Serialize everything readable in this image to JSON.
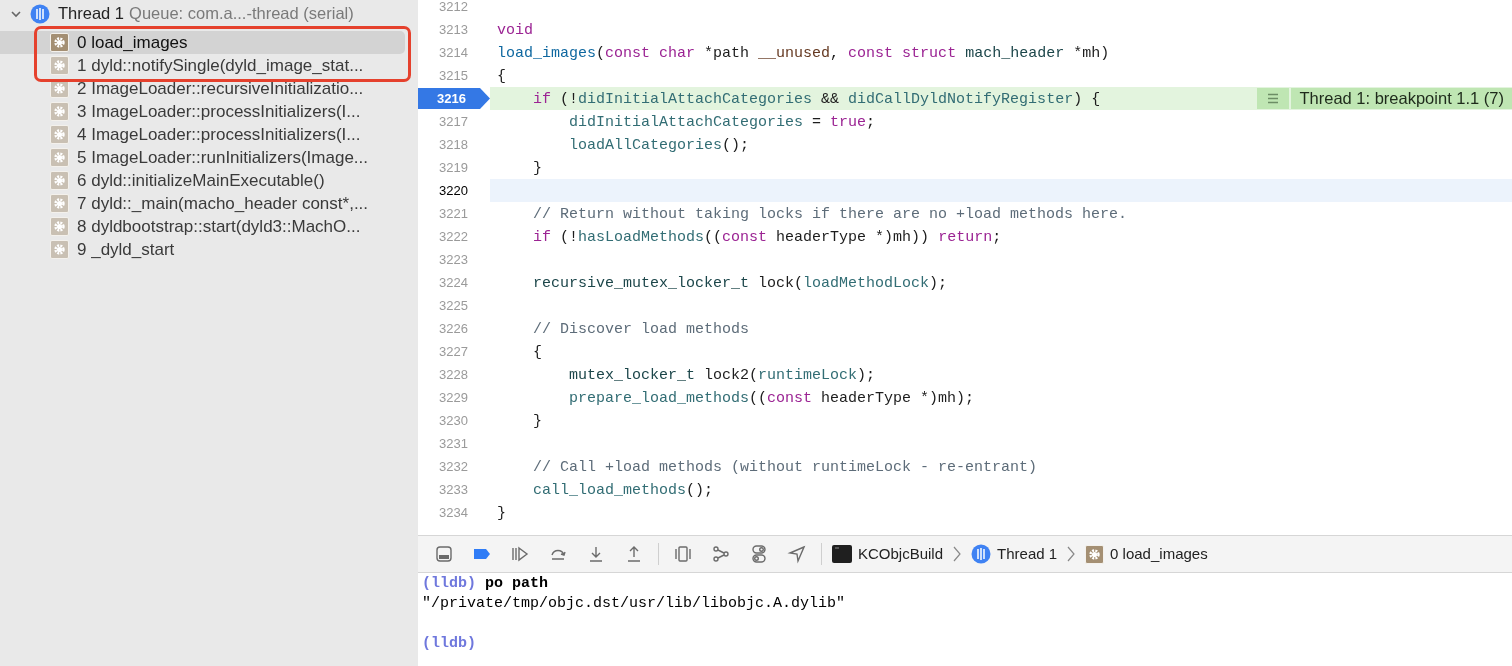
{
  "sidebar": {
    "thread": {
      "label": "Thread 1",
      "queue": "Queue: com.a...-thread (serial)",
      "expanded": true
    },
    "frames": [
      {
        "label": "0 load_images",
        "selected": true,
        "highlighted": true
      },
      {
        "label": "1 dyld::notifySingle(dyld_image_stat...",
        "selected": false,
        "highlighted": true
      },
      {
        "label": "2 ImageLoader::recursiveInitializatio...",
        "selected": false,
        "highlighted": false
      },
      {
        "label": "3 ImageLoader::processInitializers(I...",
        "selected": false,
        "highlighted": false
      },
      {
        "label": "4 ImageLoader::processInitializers(I...",
        "selected": false,
        "highlighted": false
      },
      {
        "label": "5 ImageLoader::runInitializers(Image...",
        "selected": false,
        "highlighted": false
      },
      {
        "label": "6 dyld::initializeMainExecutable()",
        "selected": false,
        "highlighted": false
      },
      {
        "label": "7 dyld::_main(macho_header const*,...",
        "selected": false,
        "highlighted": false
      },
      {
        "label": "8 dyldbootstrap::start(dyld3::MachO...",
        "selected": false,
        "highlighted": false
      },
      {
        "label": "9 _dyld_start",
        "selected": false,
        "highlighted": false
      }
    ]
  },
  "editor": {
    "lines": [
      {
        "number": "3212",
        "breakpoint": false,
        "cursor": false
      },
      {
        "number": "3213",
        "breakpoint": false,
        "cursor": false,
        "tokens": [
          {
            "text": "void",
            "kind": "keyword"
          }
        ]
      },
      {
        "number": "3214",
        "breakpoint": false,
        "cursor": false,
        "tokens": [
          {
            "text": "load_images",
            "kind": "decl"
          },
          {
            "text": "(",
            "kind": "plain"
          },
          {
            "text": "const char",
            "kind": "keyword"
          },
          {
            "text": " *path ",
            "kind": "plain"
          },
          {
            "text": "__unused",
            "kind": "macro"
          },
          {
            "text": ", ",
            "kind": "plain"
          },
          {
            "text": "const struct",
            "kind": "keyword"
          },
          {
            "text": " mach_header",
            "kind": "type"
          },
          {
            "text": " *mh)",
            "kind": "plain"
          }
        ]
      },
      {
        "number": "3215",
        "breakpoint": false,
        "cursor": false,
        "tokens": [
          {
            "text": "{",
            "kind": "plain"
          }
        ]
      },
      {
        "number": "3216",
        "breakpoint": true,
        "cursor": false,
        "annotation": "Thread 1: breakpoint 1.1 (7)",
        "tokens": [
          {
            "text": "    if",
            "kind": "keyword"
          },
          {
            "text": " (!",
            "kind": "plain"
          },
          {
            "text": "didInitialAttachCategories",
            "kind": "symbol"
          },
          {
            "text": " && ",
            "kind": "plain"
          },
          {
            "text": "didCallDyldNotifyRegister",
            "kind": "symbol"
          },
          {
            "text": ") {",
            "kind": "plain"
          }
        ]
      },
      {
        "number": "3217",
        "breakpoint": false,
        "cursor": false,
        "tokens": [
          {
            "text": "        didInitialAttachCategories",
            "kind": "symbol"
          },
          {
            "text": " = ",
            "kind": "plain"
          },
          {
            "text": "true",
            "kind": "keyword"
          },
          {
            "text": ";",
            "kind": "plain"
          }
        ]
      },
      {
        "number": "3218",
        "breakpoint": false,
        "cursor": false,
        "tokens": [
          {
            "text": "        loadAllCategories",
            "kind": "symbol"
          },
          {
            "text": "();",
            "kind": "plain"
          }
        ]
      },
      {
        "number": "3219",
        "breakpoint": false,
        "cursor": false,
        "tokens": [
          {
            "text": "    }",
            "kind": "plain"
          }
        ]
      },
      {
        "number": "3220",
        "breakpoint": false,
        "cursor": true
      },
      {
        "number": "3221",
        "breakpoint": false,
        "cursor": false,
        "tokens": [
          {
            "text": "    // Return without taking locks if there are no +load methods here.",
            "kind": "comment"
          }
        ]
      },
      {
        "number": "3222",
        "breakpoint": false,
        "cursor": false,
        "tokens": [
          {
            "text": "    if",
            "kind": "keyword"
          },
          {
            "text": " (!",
            "kind": "plain"
          },
          {
            "text": "hasLoadMethods",
            "kind": "symbol"
          },
          {
            "text": "((",
            "kind": "plain"
          },
          {
            "text": "const",
            "kind": "keyword"
          },
          {
            "text": " headerType *)mh)) ",
            "kind": "plain"
          },
          {
            "text": "return",
            "kind": "keyword"
          },
          {
            "text": ";",
            "kind": "plain"
          }
        ]
      },
      {
        "number": "3223",
        "breakpoint": false,
        "cursor": false
      },
      {
        "number": "3224",
        "breakpoint": false,
        "cursor": false,
        "tokens": [
          {
            "text": "    recursive_mutex_locker_t",
            "kind": "type"
          },
          {
            "text": " lock(",
            "kind": "plain"
          },
          {
            "text": "loadMethodLock",
            "kind": "symbol"
          },
          {
            "text": ");",
            "kind": "plain"
          }
        ]
      },
      {
        "number": "3225",
        "breakpoint": false,
        "cursor": false
      },
      {
        "number": "3226",
        "breakpoint": false,
        "cursor": false,
        "tokens": [
          {
            "text": "    // Discover load methods",
            "kind": "comment"
          }
        ]
      },
      {
        "number": "3227",
        "breakpoint": false,
        "cursor": false,
        "tokens": [
          {
            "text": "    {",
            "kind": "plain"
          }
        ]
      },
      {
        "number": "3228",
        "breakpoint": false,
        "cursor": false,
        "tokens": [
          {
            "text": "        mutex_locker_t",
            "kind": "type"
          },
          {
            "text": " lock2(",
            "kind": "plain"
          },
          {
            "text": "runtimeLock",
            "kind": "symbol"
          },
          {
            "text": ");",
            "kind": "plain"
          }
        ]
      },
      {
        "number": "3229",
        "breakpoint": false,
        "cursor": false,
        "tokens": [
          {
            "text": "        prepare_load_methods",
            "kind": "symbol"
          },
          {
            "text": "((",
            "kind": "plain"
          },
          {
            "text": "const",
            "kind": "keyword"
          },
          {
            "text": " headerType *)mh);",
            "kind": "plain"
          }
        ]
      },
      {
        "number": "3230",
        "breakpoint": false,
        "cursor": false,
        "tokens": [
          {
            "text": "    }",
            "kind": "plain"
          }
        ]
      },
      {
        "number": "3231",
        "breakpoint": false,
        "cursor": false
      },
      {
        "number": "3232",
        "breakpoint": false,
        "cursor": false,
        "tokens": [
          {
            "text": "    // Call +load methods (without runtimeLock - re-entrant)",
            "kind": "comment"
          }
        ]
      },
      {
        "number": "3233",
        "breakpoint": false,
        "cursor": false,
        "tokens": [
          {
            "text": "    call_load_methods",
            "kind": "symbol"
          },
          {
            "text": "();",
            "kind": "plain"
          }
        ]
      },
      {
        "number": "3234",
        "breakpoint": false,
        "cursor": false,
        "tokens": [
          {
            "text": "}",
            "kind": "plain"
          }
        ]
      }
    ]
  },
  "debug_bar": {
    "breadcrumb": [
      {
        "kind": "terminal",
        "label": "KCObjcBuild"
      },
      {
        "kind": "thread",
        "label": "Thread 1"
      },
      {
        "kind": "frame",
        "label": "0 load_images"
      }
    ]
  },
  "console": {
    "lines": [
      {
        "kind": "command",
        "prompt": "(lldb)",
        "text": "po path"
      },
      {
        "kind": "output",
        "text": "\"/private/tmp/objc.dst/usr/lib/libobjc.A.dylib\""
      },
      {
        "kind": "blank"
      },
      {
        "kind": "command",
        "prompt": "(lldb)"
      }
    ]
  }
}
